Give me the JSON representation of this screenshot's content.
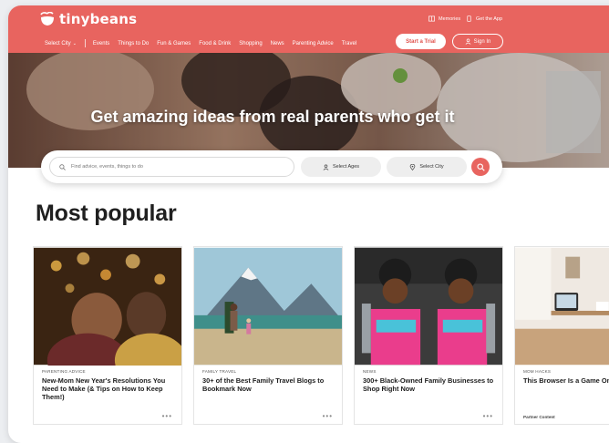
{
  "header": {
    "brand": "tinybeans",
    "links": [
      {
        "label": "Memories",
        "icon": "book-icon"
      },
      {
        "label": "Get the App",
        "icon": "phone-icon"
      }
    ],
    "select_city": "Select City",
    "nav": [
      "Events",
      "Things to Do",
      "Fun & Games",
      "Food & Drink",
      "Shopping",
      "News",
      "Parenting Advice",
      "Travel"
    ],
    "trial_label": "Start a Trial",
    "signin_label": "Sign In"
  },
  "hero": {
    "title": "Get amazing ideas from real parents who get it"
  },
  "search": {
    "placeholder": "Find advice, events, things to do",
    "ages_label": "Select Ages",
    "city_label": "Select City"
  },
  "section": {
    "title": "Most popular"
  },
  "cards": [
    {
      "category": "PARENTING ADVICE",
      "title": "New-Mom New Year's Resolutions You Need to Make (& Tips on How to Keep Them!)",
      "more": "•••"
    },
    {
      "category": "FAMILY TRAVEL",
      "title": "30+ of the Best Family Travel Blogs to Bookmark Now",
      "more": "•••"
    },
    {
      "category": "NEWS",
      "title": "300+ Black-Owned Family Businesses to Shop Right Now",
      "more": "•••"
    },
    {
      "category": "MOM HACKS",
      "title": "This Browser Is a Game Online Shopping",
      "partner": "Partner Content"
    }
  ],
  "colors": {
    "brand": "#e8645f",
    "text_dark": "#1d1d1d"
  }
}
